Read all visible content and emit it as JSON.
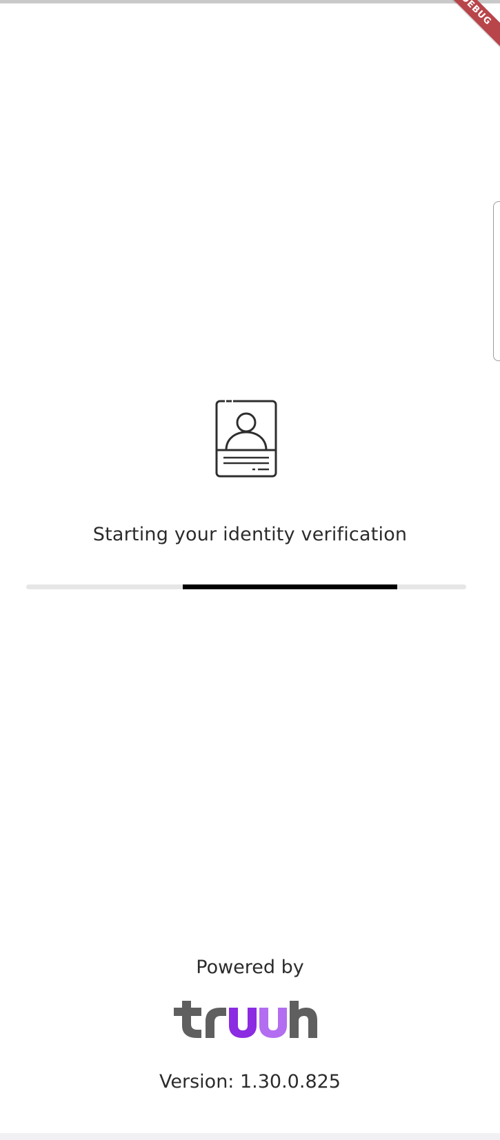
{
  "debug_banner": {
    "label": "DEBUG"
  },
  "loading": {
    "icon": "id-card-icon",
    "status_text": "Starting your identity verification",
    "progress": "indeterminate"
  },
  "footer": {
    "powered_by": "Powered by",
    "brand": {
      "name": "truuth",
      "icon": "truuth-logo",
      "colors": {
        "gray": "#5f5f5f",
        "purple_dark": "#8b2be2",
        "purple_light": "#b36df0"
      }
    },
    "version_text": "Version: 1.30.0.825"
  },
  "colors": {
    "background": "#ffffff",
    "text": "#2b2b2b",
    "progress_track": "#e6e6e6",
    "progress_indicator": "#000000",
    "debug_ribbon": "#b8454a"
  }
}
